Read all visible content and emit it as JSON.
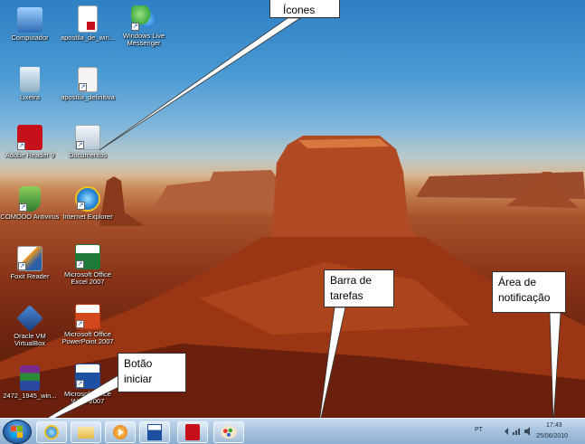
{
  "desktop_icons": [
    {
      "label": "Computador"
    },
    {
      "label": "apostila_de_win..."
    },
    {
      "label": "Windows Live Messenger"
    },
    {
      "label": "Lixeira"
    },
    {
      "label": "apostila_definitiva"
    },
    {
      "label": "Adobe Reader 9"
    },
    {
      "label": "Documentos"
    },
    {
      "label": "COMODO Antivirus"
    },
    {
      "label": "Internet Explorer"
    },
    {
      "label": "Foxit Reader"
    },
    {
      "label": "Microsoft Office Excel 2007"
    },
    {
      "label": "Oracle VM VirtualBox"
    },
    {
      "label": "Microsoft Office PowerPoint 2007"
    },
    {
      "label": "2472_1945_win..."
    },
    {
      "label": "Microsoft Office Word 2007"
    }
  ],
  "callouts": {
    "icones": "Ícones",
    "barra_line1": "Barra de",
    "barra_line2": "tarefas",
    "area_line1": "Área de",
    "area_line2": "notificação",
    "botao_line1": "Botão",
    "botao_line2": "iniciar"
  },
  "taskbar": {
    "language": "PT",
    "time": "17:43",
    "date": "25/06/2010",
    "pinned": [
      "internet-explorer",
      "windows-explorer",
      "media-player",
      "word",
      "adobe-reader",
      "paint"
    ]
  }
}
